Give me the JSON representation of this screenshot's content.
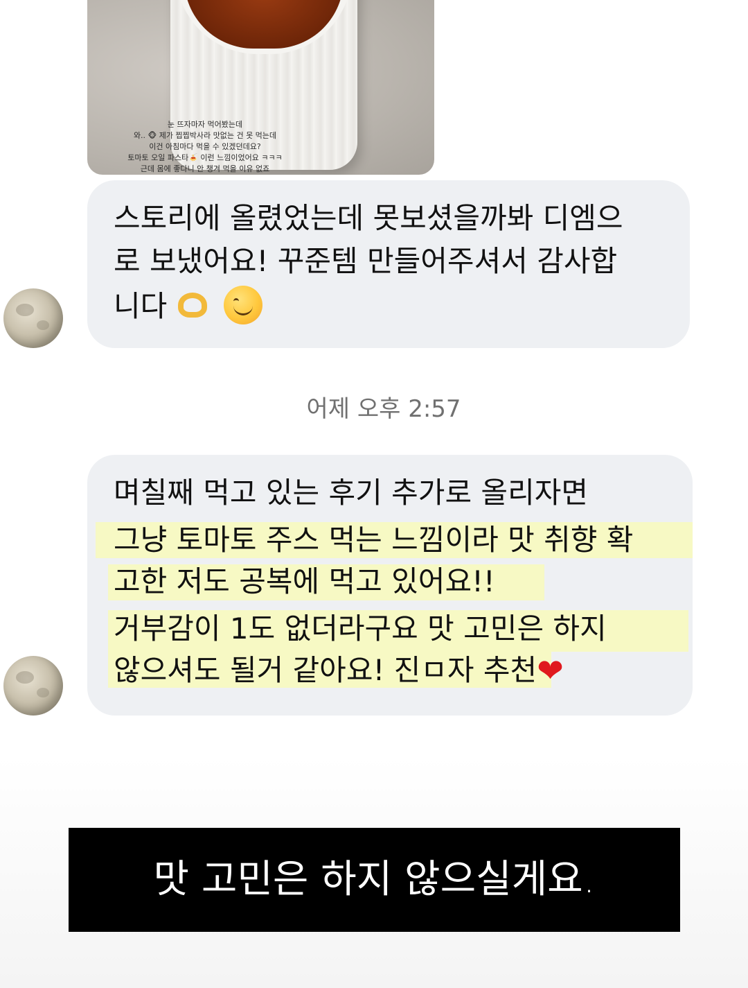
{
  "shared_story": {
    "caption_lines": [
      "눈 뜨자마자 먹어봤는데",
      "와.. 🐵 제가 찝찝박사라 맛없는 건 못 먹는데",
      "이건 아침마다 먹을 수 있겠던데요?",
      "토마토 오일 파스타🍝 이런 느낌이었어요 ㅋㅋㅋ",
      "근데 몸에 좋다니 안 챙겨 먹을 이유 없죠"
    ]
  },
  "messages": [
    {
      "lines": [
        "스토리에 올렸었는데 못보셨을까봐 디엠으",
        "로 보냈어요! 꾸준템 만들어주셔서 감사합",
        "니다"
      ],
      "emojis": [
        "heart-hands",
        "smiling-face"
      ]
    },
    {
      "lines": [
        "며칠째 먹고 있는 후기 추가로 올리자면",
        "그냥 토마토 주스 먹는 느낌이라 맛 취향 확",
        "고한 저도 공복에 먹고 있어요!!",
        "거부감이 1도 없더라구요 맛 고민은 하지",
        "않으셔도 될거 같아요! 진ㅁ자 추천"
      ],
      "emojis": [
        "red-heart"
      ]
    }
  ],
  "timestamp": "어제 오후 2:57",
  "caption": "맛 고민은 하지 않으실게요.",
  "colors": {
    "bubble": "#eef0f3",
    "highlight": "#f7f9c4",
    "caption_bg": "#000000",
    "caption_text": "#ffffff"
  }
}
